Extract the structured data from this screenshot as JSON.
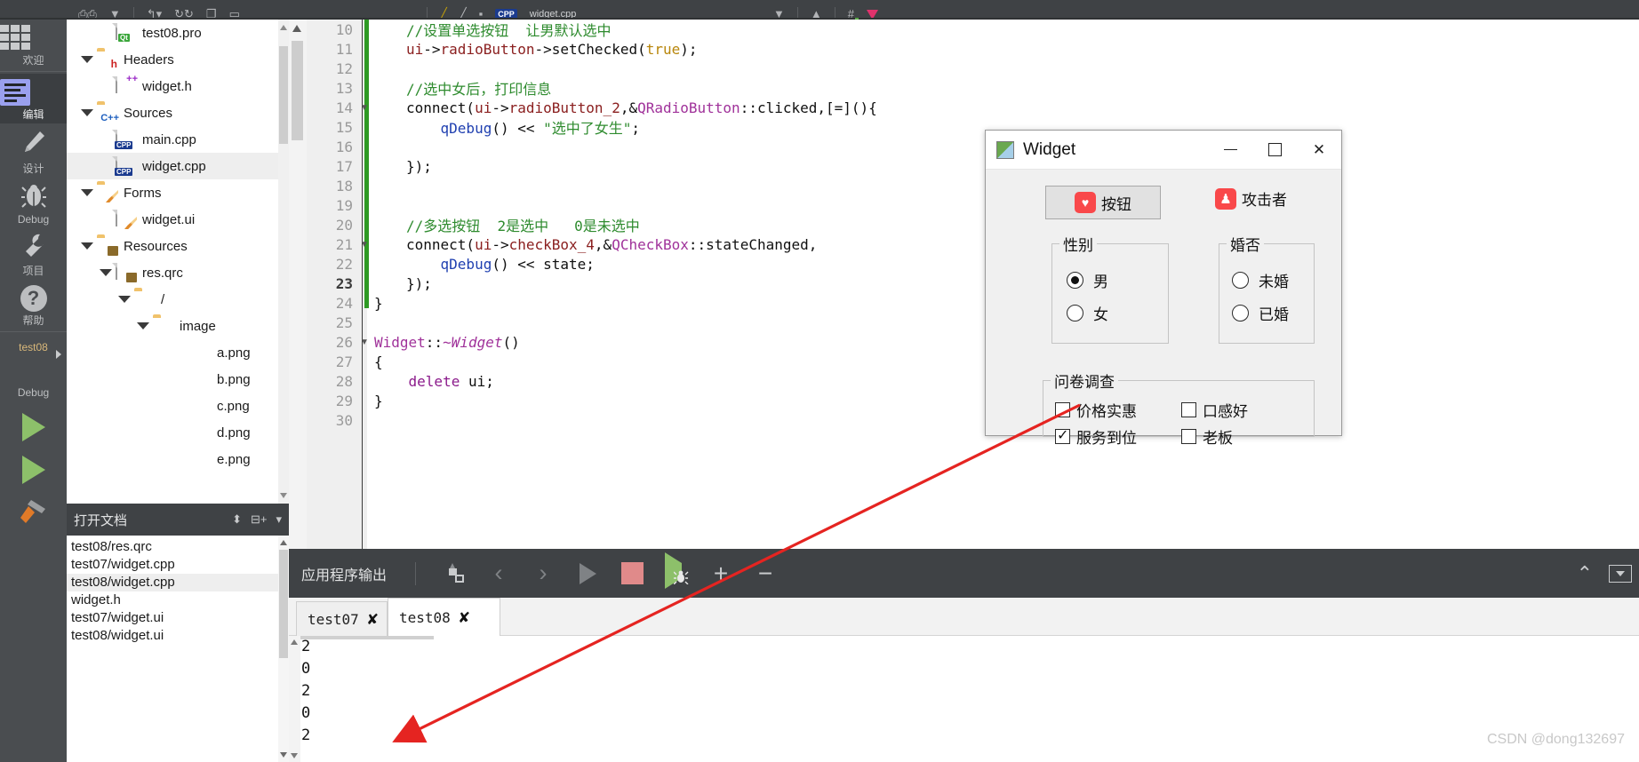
{
  "toolbar": {
    "cpp_badge": "CPP",
    "tab_label": "widget.cpp"
  },
  "activity_bar": {
    "items": [
      {
        "label": "欢迎",
        "icon": "grid-icon",
        "selected": false
      },
      {
        "label": "编辑",
        "icon": "edit-lines-icon",
        "selected": true
      },
      {
        "label": "设计",
        "icon": "pencil-icon",
        "selected": false
      },
      {
        "label": "Debug",
        "icon": "bug-icon",
        "selected": false
      },
      {
        "label": "项目",
        "icon": "wrench-icon",
        "selected": false
      },
      {
        "label": "帮助",
        "icon": "question-icon",
        "selected": false
      }
    ],
    "kit": {
      "project": "test08",
      "mode": "Debug",
      "icon": "monitor-icon"
    }
  },
  "project_tree": {
    "rows": [
      {
        "label": "test08.pro",
        "indent": 1,
        "icon": "qt-project-file-icon",
        "caret": false,
        "selected": false
      },
      {
        "label": "Headers",
        "indent": 0,
        "icon": "folder-headers-icon",
        "caret": true,
        "selected": false
      },
      {
        "label": "widget.h",
        "indent": 1,
        "icon": "header-file-icon",
        "caret": false,
        "selected": false
      },
      {
        "label": "Sources",
        "indent": 0,
        "icon": "folder-sources-icon",
        "caret": true,
        "selected": false
      },
      {
        "label": "main.cpp",
        "indent": 1,
        "icon": "cpp-file-icon",
        "caret": false,
        "selected": false
      },
      {
        "label": "widget.cpp",
        "indent": 1,
        "icon": "cpp-file-icon",
        "caret": false,
        "selected": true
      },
      {
        "label": "Forms",
        "indent": 0,
        "icon": "folder-forms-icon",
        "caret": true,
        "selected": false
      },
      {
        "label": "widget.ui",
        "indent": 1,
        "icon": "ui-file-icon",
        "caret": false,
        "selected": false
      },
      {
        "label": "Resources",
        "indent": 0,
        "icon": "folder-resources-icon",
        "caret": true,
        "selected": false
      },
      {
        "label": "res.qrc",
        "indent": 1,
        "icon": "qrc-file-icon",
        "caret": true,
        "selected": false
      },
      {
        "label": "/",
        "indent": 2,
        "icon": "folder-icon",
        "caret": true,
        "selected": false
      },
      {
        "label": "image",
        "indent": 3,
        "icon": "folder-icon",
        "caret": true,
        "selected": false
      },
      {
        "label": "a.png",
        "indent": 5,
        "icon": "none",
        "caret": false,
        "selected": false
      },
      {
        "label": "b.png",
        "indent": 5,
        "icon": "none",
        "caret": false,
        "selected": false
      },
      {
        "label": "c.png",
        "indent": 5,
        "icon": "none",
        "caret": false,
        "selected": false
      },
      {
        "label": "d.png",
        "indent": 5,
        "icon": "none",
        "caret": false,
        "selected": false
      },
      {
        "label": "e.png",
        "indent": 5,
        "icon": "none",
        "caret": false,
        "selected": false
      }
    ]
  },
  "open_documents": {
    "title": "打开文档",
    "sort_icon": "sort-updown-icon",
    "split_icon": "split-add-icon",
    "menu_icon": "dropdown-icon",
    "items": [
      {
        "label": "test08/res.qrc",
        "selected": false
      },
      {
        "label": "test07/widget.cpp",
        "selected": false
      },
      {
        "label": "test08/widget.cpp",
        "selected": true
      },
      {
        "label": "widget.h",
        "selected": false
      },
      {
        "label": "test07/widget.ui",
        "selected": false
      },
      {
        "label": "test08/widget.ui",
        "selected": false
      }
    ]
  },
  "editor": {
    "current_line": 23,
    "lines": [
      {
        "num": 10,
        "fold": false,
        "html": "<span class='c-cmt'>//设置单选按钮  让男默认选中</span>",
        "indent": 4
      },
      {
        "num": 11,
        "fold": false,
        "html": "<span class='c-mem'>ui</span>-&gt;<span class='c-mem'>radioButton</span>-&gt;setChecked(<span class='c-num'>true</span>);",
        "indent": 4
      },
      {
        "num": 12,
        "fold": false,
        "html": "",
        "indent": 4
      },
      {
        "num": 13,
        "fold": false,
        "html": "<span class='c-cmt'>//选中女后，打印信息</span>",
        "indent": 4
      },
      {
        "num": 14,
        "fold": true,
        "html": "connect(<span class='c-mem'>ui</span>-&gt;<span class='c-mem'>radioButton_2</span>,&amp;<span class='c-type'>QRadioButton</span>::clicked,[=](){",
        "indent": 4
      },
      {
        "num": 15,
        "fold": false,
        "html": "    <span class='c-blue'>qDebug</span>() &lt;&lt; <span class='c-str'>\"选中了女生\"</span>;",
        "indent": 4
      },
      {
        "num": 16,
        "fold": false,
        "html": "",
        "indent": 4
      },
      {
        "num": 17,
        "fold": false,
        "html": "});",
        "indent": 4
      },
      {
        "num": 18,
        "fold": false,
        "html": "",
        "indent": 4
      },
      {
        "num": 19,
        "fold": false,
        "html": "",
        "indent": 4
      },
      {
        "num": 20,
        "fold": false,
        "html": "<span class='c-cmt'>//多选按钮  2是选中   0是未选中</span>",
        "indent": 4
      },
      {
        "num": 21,
        "fold": true,
        "html": "connect(<span class='c-mem'>ui</span>-&gt;<span class='c-mem'>checkBox_4</span>,&amp;<span class='c-type'>QCheckBox</span>::stateChanged,",
        "indent": 4
      },
      {
        "num": 22,
        "fold": false,
        "html": "    <span class='c-blue'>qDebug</span>() &lt;&lt; state;",
        "indent": 4
      },
      {
        "num": 23,
        "fold": false,
        "html": "});",
        "indent": 4
      },
      {
        "num": 24,
        "fold": false,
        "html": "}",
        "indent": 0
      },
      {
        "num": 25,
        "fold": false,
        "html": "",
        "indent": 0
      },
      {
        "num": 26,
        "fold": true,
        "html": "<span class='c-type'>Widget</span>::<span class='c-type' style='font-style:italic'>~Widget</span>()",
        "indent": 0
      },
      {
        "num": 27,
        "fold": false,
        "html": "{",
        "indent": 0
      },
      {
        "num": 28,
        "fold": false,
        "html": "    <span class='c-kw'>delete</span> ui;",
        "indent": 0
      },
      {
        "num": 29,
        "fold": false,
        "html": "}",
        "indent": 0
      },
      {
        "num": 30,
        "fold": false,
        "html": "",
        "indent": 0
      }
    ]
  },
  "widget_dialog": {
    "title": "Widget",
    "titlebar": {
      "minimize": "—",
      "maximize": "□",
      "close": "✕"
    },
    "push_button": {
      "label": "按钮",
      "icon": "heart-icon"
    },
    "attacker": {
      "label": "攻击者",
      "icon": "attacker-icon"
    },
    "gender_group": {
      "title": "性别",
      "options": [
        {
          "label": "男",
          "checked": true
        },
        {
          "label": "女",
          "checked": false
        }
      ]
    },
    "marriage_group": {
      "title": "婚否",
      "options": [
        {
          "label": "未婚",
          "checked": false
        },
        {
          "label": "已婚",
          "checked": false
        }
      ]
    },
    "survey_group": {
      "title": "问卷调查",
      "options": [
        {
          "label": "价格实惠",
          "checked": false
        },
        {
          "label": "口感好",
          "checked": false
        },
        {
          "label": "服务到位",
          "checked": true
        },
        {
          "label": "老板",
          "checked": false
        }
      ]
    }
  },
  "output_pane": {
    "title": "应用程序输出",
    "buttons": [
      {
        "name": "clear-icon",
        "glyph": "clean"
      },
      {
        "name": "prev-icon",
        "glyph": "‹"
      },
      {
        "name": "next-icon",
        "glyph": "›"
      },
      {
        "name": "run-icon",
        "glyph": "▶"
      },
      {
        "name": "stop-icon",
        "glyph": "■"
      },
      {
        "name": "debug-icon",
        "glyph": "▶bug"
      },
      {
        "name": "zoom-in-icon",
        "glyph": "+"
      },
      {
        "name": "zoom-out-icon",
        "glyph": "−"
      }
    ],
    "collapse_icon": "chevron-up-icon",
    "menu_icon": "dropdown-icon",
    "tabs": [
      {
        "label": "test07",
        "active": false
      },
      {
        "label": "test08",
        "active": true
      }
    ],
    "lines": [
      "2",
      "0",
      "2",
      "0",
      "2"
    ]
  },
  "watermark": "CSDN @dong132697",
  "colors": {
    "accent_red": "#f9484a",
    "green_bar": "#2e9a24",
    "annotation": "#e52421",
    "dark_chrome": "#3f4245",
    "activity_bar": "#4a4d50"
  }
}
